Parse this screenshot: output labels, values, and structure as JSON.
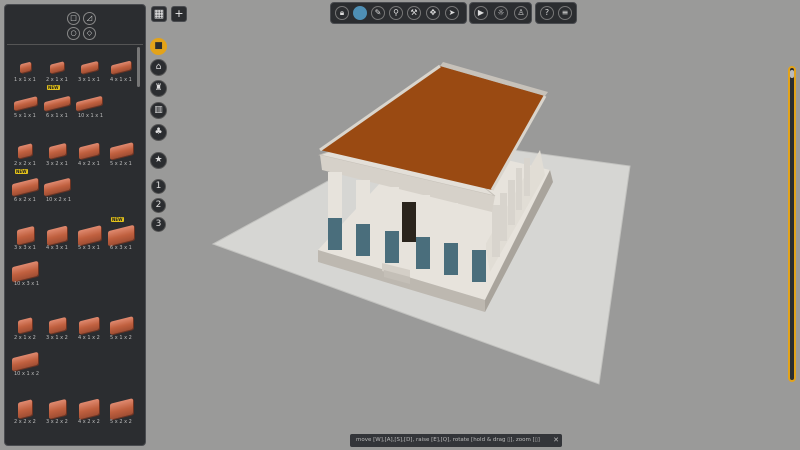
{
  "library": {
    "groups": [
      {
        "items": [
          {
            "label": "1 x 1 x 1",
            "badge": ""
          },
          {
            "label": "2 x 1 x 1",
            "badge": ""
          },
          {
            "label": "3 x 1 x 1",
            "badge": ""
          },
          {
            "label": "4 x 1 x 1",
            "badge": ""
          },
          {
            "label": "5 x 1 x 1",
            "badge": ""
          },
          {
            "label": "6 x 1 x 1",
            "badge": "NEW"
          },
          {
            "label": "10 x 1 x 1",
            "badge": ""
          }
        ]
      },
      {
        "items": [
          {
            "label": "2 x 2 x 1",
            "badge": ""
          },
          {
            "label": "3 x 2 x 1",
            "badge": ""
          },
          {
            "label": "4 x 2 x 1",
            "badge": ""
          },
          {
            "label": "5 x 2 x 1",
            "badge": ""
          },
          {
            "label": "6 x 2 x 1",
            "badge": "NEW"
          },
          {
            "label": "10 x 2 x 1",
            "badge": ""
          }
        ]
      },
      {
        "items": [
          {
            "label": "3 x 3 x 1",
            "badge": ""
          },
          {
            "label": "4 x 3 x 1",
            "badge": ""
          },
          {
            "label": "5 x 3 x 1",
            "badge": ""
          },
          {
            "label": "6 x 3 x 1",
            "badge": "NEW"
          },
          {
            "label": "10 x 3 x 1",
            "badge": ""
          }
        ]
      },
      {
        "items": [
          {
            "label": "2 x 1 x 2",
            "badge": ""
          },
          {
            "label": "3 x 1 x 2",
            "badge": ""
          },
          {
            "label": "4 x 1 x 2",
            "badge": ""
          },
          {
            "label": "5 x 1 x 2",
            "badge": ""
          },
          {
            "label": "10 x 1 x 2",
            "badge": ""
          }
        ]
      },
      {
        "items": [
          {
            "label": "2 x 2 x 2",
            "badge": ""
          },
          {
            "label": "3 x 2 x 2",
            "badge": ""
          },
          {
            "label": "4 x 2 x 2",
            "badge": ""
          },
          {
            "label": "5 x 2 x 2",
            "badge": ""
          }
        ]
      }
    ]
  },
  "top_left_buttons": {
    "grid": "▦",
    "add": "+"
  },
  "category_icons": [
    "cube-icon",
    "temple-icon",
    "tower-icon",
    "buildings-icon",
    "tree-icon",
    "star-icon"
  ],
  "layers": [
    "1",
    "2",
    "3"
  ],
  "toolbar": {
    "tools": [
      "lock-icon",
      "paint-icon",
      "pipette-icon",
      "wand-icon",
      "hammer-icon",
      "move-icon",
      "cursor-icon"
    ],
    "right1": [
      "play-icon",
      "sun-icon",
      "walk-icon"
    ],
    "right2": [
      "help-icon",
      "menu-icon"
    ]
  },
  "hint": {
    "text": "move [W],[A],[S],[D], raise [E],[Q], rotate [hold & drag ▯], zoom [▯]",
    "close": "✕"
  },
  "colors": {
    "accent": "#e3a31a",
    "active_tool": "#4e8fb5",
    "roof": "#9a4a12",
    "ground": "#d9d9d6"
  }
}
